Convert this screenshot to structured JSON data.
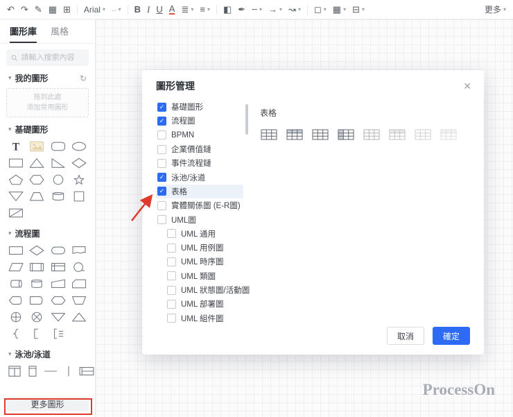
{
  "toolbar": {
    "caret_glyph": "▾",
    "items": [
      {
        "type": "icon",
        "name": "undo",
        "glyph": "↶"
      },
      {
        "type": "icon",
        "name": "redo",
        "glyph": "↷"
      },
      {
        "type": "icon",
        "name": "format-painter",
        "glyph": "✎"
      },
      {
        "type": "icon",
        "name": "theme",
        "glyph": "▦"
      },
      {
        "type": "icon",
        "name": "fit-screen",
        "glyph": "⊞"
      },
      {
        "type": "sep"
      },
      {
        "type": "select",
        "name": "font-family",
        "label": "Arial"
      },
      {
        "type": "select",
        "name": "font-size",
        "label": "–",
        "disabled": true
      },
      {
        "type": "sep"
      },
      {
        "type": "icon",
        "name": "bold",
        "glyph": "B",
        "style": "bold"
      },
      {
        "type": "icon",
        "name": "italic",
        "glyph": "I",
        "style": "italic"
      },
      {
        "type": "icon",
        "name": "underline",
        "glyph": "U",
        "style": "underline"
      },
      {
        "type": "icon",
        "name": "font-color",
        "glyph": "A",
        "style": "acolor"
      },
      {
        "type": "icon",
        "name": "text-align",
        "glyph": "≣",
        "caret": true
      },
      {
        "type": "icon",
        "name": "line-spacing",
        "glyph": "≡",
        "caret": true
      },
      {
        "type": "sep"
      },
      {
        "type": "icon",
        "name": "fill-color",
        "glyph": "◧"
      },
      {
        "type": "icon",
        "name": "line-color",
        "glyph": "✒"
      },
      {
        "type": "icon",
        "name": "line-style",
        "glyph": "╌",
        "caret": true
      },
      {
        "type": "icon",
        "name": "arrow-style",
        "glyph": "→",
        "caret": true
      },
      {
        "type": "icon",
        "name": "connector-type",
        "glyph": "↝",
        "caret": true
      },
      {
        "type": "sep"
      },
      {
        "type": "icon",
        "name": "shape-style",
        "glyph": "◻",
        "caret": true
      },
      {
        "type": "icon",
        "name": "insert-table",
        "glyph": "▦",
        "caret": true
      },
      {
        "type": "icon",
        "name": "layout",
        "glyph": "⊟",
        "caret": true
      },
      {
        "type": "more",
        "name": "more",
        "label": "更多",
        "caret": true
      }
    ]
  },
  "sidebar": {
    "tabs": [
      {
        "label": "圖形庫",
        "active": true
      },
      {
        "label": "風格",
        "active": false
      }
    ],
    "search_placeholder": "請輸入搜索內容",
    "section_caret": "▾",
    "refresh_glyph": "↻",
    "sections": {
      "my_shapes": {
        "title": "我的圖形",
        "dropzone_line1": "拖到此處",
        "dropzone_line2": "添加常用圖形"
      },
      "basic": {
        "title": "基礎圖形",
        "shapes": [
          "text",
          "image",
          "rounded-rect",
          "ellipse",
          "rect",
          "triangle",
          "right-triangle",
          "diamond",
          "pentagon",
          "hexagon",
          "circle",
          "star",
          "inverted-triangle",
          "trapezoid",
          "cylinder",
          "square",
          "diagonal-rect"
        ]
      },
      "flowchart": {
        "title": "流程圖",
        "shapes": [
          "process",
          "decision",
          "terminator",
          "document",
          "data",
          "predefined-process",
          "internal-storage",
          "sequential-data",
          "direct-data",
          "database",
          "manual-input",
          "card",
          "display",
          "delay",
          "preparation",
          "manual-operation",
          "or-junction",
          "summing-junction",
          "merge",
          "extract",
          "left-brace",
          "left-bracket",
          "annotation"
        ]
      },
      "swimlane": {
        "title": "泳池/泳道",
        "shapes": [
          "vertical-pool",
          "vertical-lane",
          "horizontal-divider",
          "vertical-divider",
          "horizontal-pool"
        ]
      }
    },
    "more_shapes_label": "更多圖形"
  },
  "modal": {
    "title": "圖形管理",
    "close_label": "✕",
    "check_glyph": "✓",
    "categories": [
      {
        "label": "基礎圖形",
        "checked": true
      },
      {
        "label": "流程圖",
        "checked": true
      },
      {
        "label": "BPMN",
        "checked": false
      },
      {
        "label": "企業價值鏈",
        "checked": false
      },
      {
        "label": "事件流程鏈",
        "checked": false
      },
      {
        "label": "泳池/泳道",
        "checked": true
      },
      {
        "label": "表格",
        "checked": true,
        "highlighted": true
      },
      {
        "label": "實體關係圖 (E-R圖)",
        "checked": false
      },
      {
        "label": "UML圖",
        "checked": false
      },
      {
        "label": "UML 通用",
        "checked": false,
        "indent": true
      },
      {
        "label": "UML 用例圖",
        "checked": false,
        "indent": true
      },
      {
        "label": "UML 時序圖",
        "checked": false,
        "indent": true
      },
      {
        "label": "UML 類圖",
        "checked": false,
        "indent": true
      },
      {
        "label": "UML 狀態圖/活動圖",
        "checked": false,
        "indent": true
      },
      {
        "label": "UML 部署圖",
        "checked": false,
        "indent": true
      },
      {
        "label": "UML 組件圖",
        "checked": false,
        "indent": true
      }
    ],
    "preview": {
      "group_title": "表格",
      "items": [
        {
          "name": "table-plain",
          "variant": "plain",
          "opacity": 1
        },
        {
          "name": "table-header-row",
          "variant": "header-row",
          "opacity": 1
        },
        {
          "name": "table-bold-grid",
          "variant": "bold",
          "opacity": 1
        },
        {
          "name": "table-header-column",
          "variant": "header-col",
          "opacity": 1
        },
        {
          "name": "table-light-1",
          "variant": "plain",
          "opacity": 0.5
        },
        {
          "name": "table-light-2",
          "variant": "header-row",
          "opacity": 0.4
        },
        {
          "name": "table-light-3",
          "variant": "plain",
          "opacity": 0.3
        },
        {
          "name": "table-light-4",
          "variant": "header-row",
          "opacity": 0.22
        }
      ]
    },
    "cancel_label": "取消",
    "confirm_label": "確定"
  },
  "watermark": "ProcessOn",
  "colors": {
    "accent_blue": "#2d6bf5",
    "annotation_red": "#e03a2c"
  }
}
